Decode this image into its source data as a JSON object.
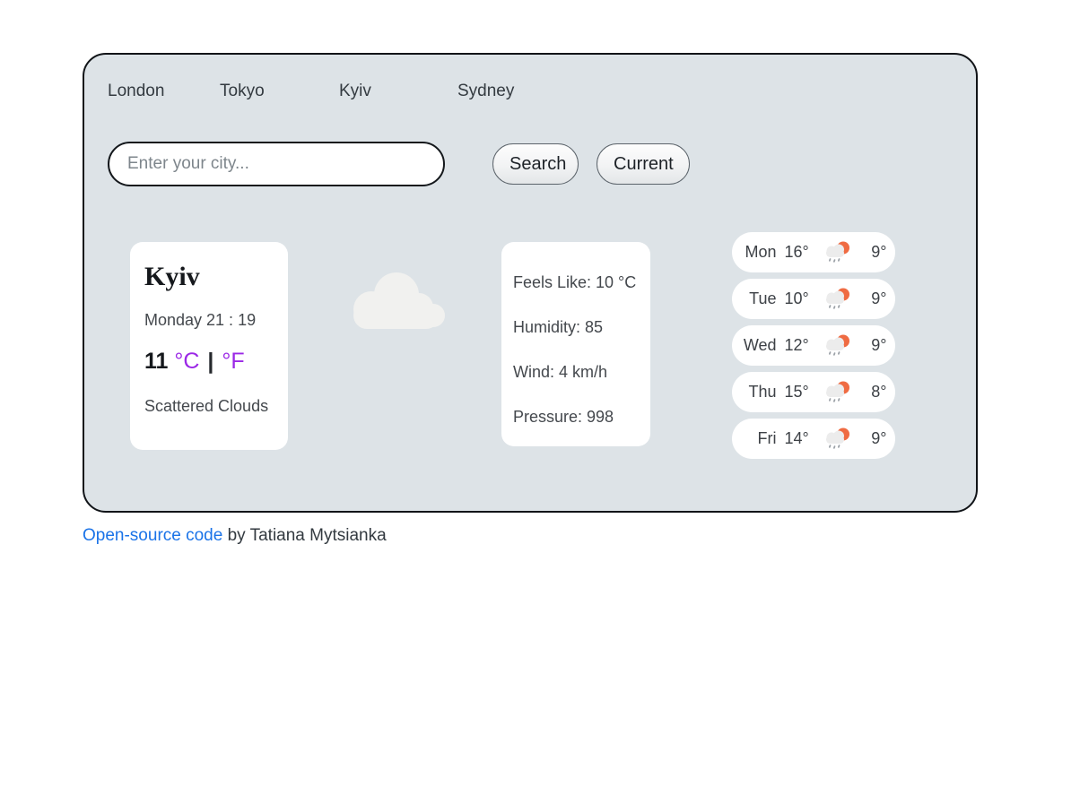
{
  "nav": {
    "cities": [
      {
        "label": "London"
      },
      {
        "label": "Tokyo"
      },
      {
        "label": "Kyiv"
      },
      {
        "label": "Sydney"
      }
    ]
  },
  "search": {
    "placeholder": "Enter your city...",
    "value": "",
    "search_label": "Search",
    "current_label": "Current"
  },
  "current": {
    "city": "Kyiv",
    "date": "Monday 21 : 19",
    "temperature": "11",
    "unit_celsius": "°C",
    "unit_separator": "|",
    "unit_fahrenheit": "°F",
    "description": "Scattered Clouds",
    "icon": "cloud-icon"
  },
  "details": {
    "rows": [
      {
        "label": "Feels Like: 10 °C"
      },
      {
        "label": "Humidity: 85"
      },
      {
        "label": "Wind: 4 km/h"
      },
      {
        "label": "Pressure: 998"
      }
    ]
  },
  "forecast": {
    "days": [
      {
        "day": "Mon",
        "max": "16°",
        "min": "9°",
        "icon": "sun-behind-rain-cloud-icon"
      },
      {
        "day": "Tue",
        "max": "10°",
        "min": "9°",
        "icon": "sun-behind-rain-cloud-icon"
      },
      {
        "day": "Wed",
        "max": "12°",
        "min": "9°",
        "icon": "sun-behind-rain-cloud-icon"
      },
      {
        "day": "Thu",
        "max": "15°",
        "min": "8°",
        "icon": "sun-behind-rain-cloud-icon"
      },
      {
        "day": "Fri",
        "max": "14°",
        "min": "9°",
        "icon": "sun-behind-rain-cloud-icon"
      }
    ]
  },
  "footer": {
    "link_label": "Open-source code",
    "credit": " by Tatiana Mytsianka"
  },
  "colors": {
    "panel_bg": "#dde3e7",
    "card_bg": "#ffffff",
    "unit_accent": "#9b28e6",
    "link_blue": "#1a73e8",
    "cloud_fill": "#f1f1ef",
    "sun_orange": "#ef6b42"
  }
}
